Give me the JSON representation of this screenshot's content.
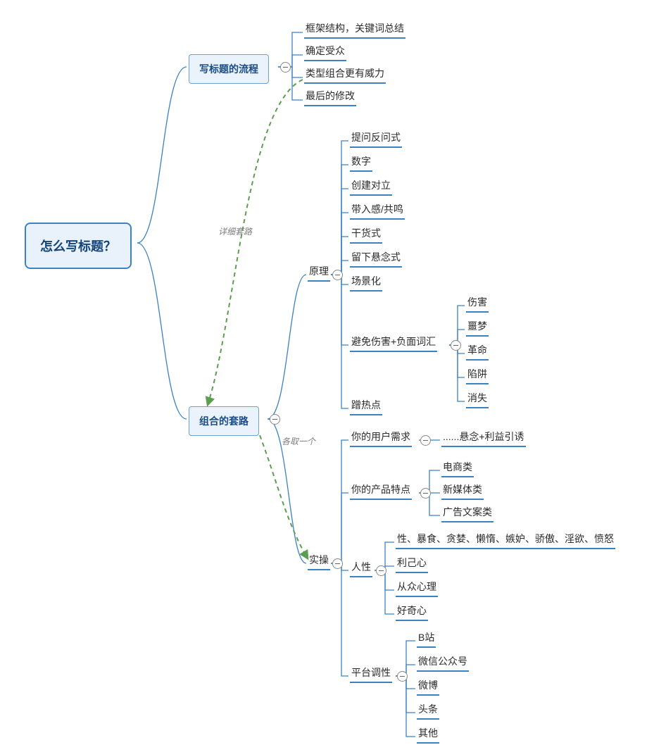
{
  "chart_data": {
    "type": "mindmap",
    "root": "怎么写标题？",
    "branches": [
      {
        "label": "写标题的流程",
        "children": [
          {
            "label": "框架结构，关键词总结"
          },
          {
            "label": "确定受众"
          },
          {
            "label": "类型组合更有威力"
          },
          {
            "label": "最后的修改"
          }
        ]
      },
      {
        "label": "组合的套路",
        "children": [
          {
            "label": "原理",
            "children": [
              {
                "label": "提问反问式"
              },
              {
                "label": "数字"
              },
              {
                "label": "创建对立"
              },
              {
                "label": "带入感/共鸣"
              },
              {
                "label": "干货式"
              },
              {
                "label": "留下悬念式"
              },
              {
                "label": "场景化"
              },
              {
                "label": "避免伤害+负面词汇",
                "children": [
                  {
                    "label": "伤害"
                  },
                  {
                    "label": "噩梦"
                  },
                  {
                    "label": "革命"
                  },
                  {
                    "label": "陷阱"
                  },
                  {
                    "label": "消失"
                  }
                ]
              },
              {
                "label": "蹭热点"
              }
            ]
          },
          {
            "label": "实操",
            "children": [
              {
                "label": "你的用户需求",
                "children": [
                  {
                    "label": "......悬念+利益引诱"
                  }
                ]
              },
              {
                "label": "你的产品特点",
                "children": [
                  {
                    "label": "电商类"
                  },
                  {
                    "label": "新媒体类"
                  },
                  {
                    "label": "广告文案类"
                  }
                ]
              },
              {
                "label": "人性",
                "children": [
                  {
                    "label": "性、暴食、贪婪、懒惰、嫉妒、骄傲、淫欲、愤怒"
                  },
                  {
                    "label": "利己心"
                  },
                  {
                    "label": "从众心理"
                  },
                  {
                    "label": "好奇心"
                  }
                ]
              },
              {
                "label": "平台调性",
                "children": [
                  {
                    "label": "B站"
                  },
                  {
                    "label": "微信公众号"
                  },
                  {
                    "label": "微博"
                  },
                  {
                    "label": "头条"
                  },
                  {
                    "label": "其他"
                  }
                ]
              }
            ]
          }
        ]
      }
    ],
    "cross_links": [
      {
        "from": "类型组合更有威力",
        "to": "组合的套路",
        "label": "详细套路"
      },
      {
        "from": "组合的套路",
        "to": "实操",
        "label": "各取一个"
      }
    ]
  },
  "root": {
    "title": "怎么写标题？"
  },
  "b1": {
    "title": "写标题的流程",
    "c1": "框架结构，关键词总结",
    "c2": "确定受众",
    "c3": "类型组合更有威力",
    "c4": "最后的修改"
  },
  "b2": {
    "title": "组合的套路",
    "p": {
      "title": "原理",
      "i1": "提问反问式",
      "i2": "数字",
      "i3": "创建对立",
      "i4": "带入感/共鸣",
      "i5": "干货式",
      "i6": "留下悬念式",
      "i7": "场景化",
      "i8": {
        "title": "避免伤害+负面词汇",
        "a": "伤害",
        "b": "噩梦",
        "c": "革命",
        "d": "陷阱",
        "e": "消失"
      },
      "i9": "蹭热点"
    },
    "s": {
      "title": "实操",
      "u": {
        "title": "你的用户需求",
        "a": "......悬念+利益引诱"
      },
      "pr": {
        "title": "你的产品特点",
        "a": "电商类",
        "b": "新媒体类",
        "c": "广告文案类"
      },
      "hn": {
        "title": "人性",
        "a": "性、暴食、贪婪、懒惰、嫉妒、骄傲、淫欲、愤怒",
        "b": "利己心",
        "c": "从众心理",
        "d": "好奇心"
      },
      "pl": {
        "title": "平台调性",
        "a": "B站",
        "b": "微信公众号",
        "c": "微博",
        "d": "头条",
        "e": "其他"
      }
    }
  },
  "links": {
    "l1": "详细套路",
    "l2": "各取一个"
  }
}
